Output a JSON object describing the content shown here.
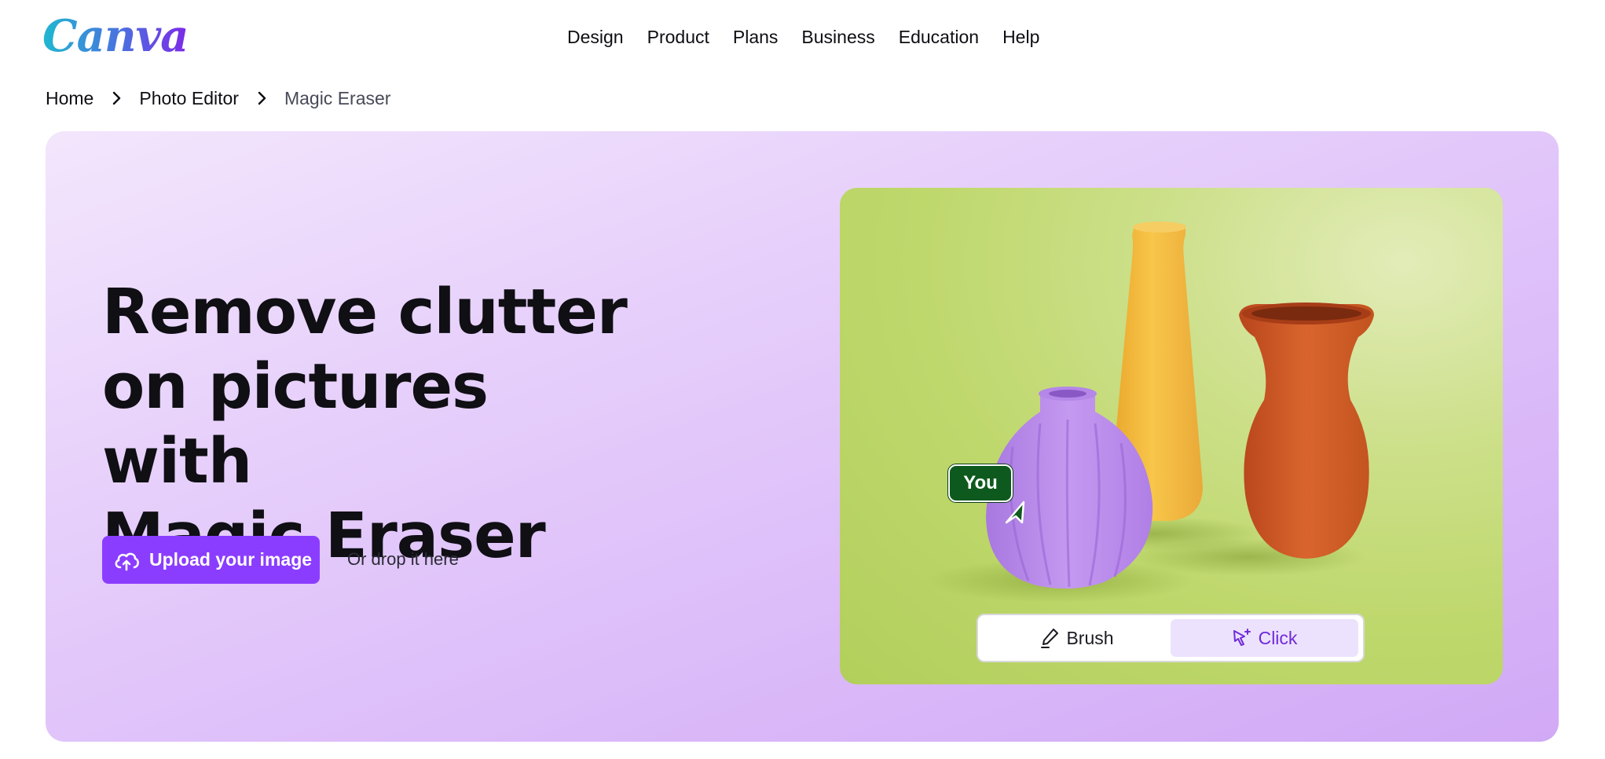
{
  "brand": {
    "logo_text": "Canva"
  },
  "nav": {
    "items": [
      "Design",
      "Product",
      "Plans",
      "Business",
      "Education",
      "Help"
    ]
  },
  "breadcrumb": {
    "items": [
      "Home",
      "Photo Editor",
      "Magic Eraser"
    ]
  },
  "hero": {
    "title_lines": [
      "Remove clutter",
      "on pictures with",
      "Magic Eraser"
    ],
    "upload_label": "Upload your image",
    "drop_text": "Or drop it here",
    "accent_color": "#8b3dff"
  },
  "preview": {
    "cursor_tag": "You",
    "tools": [
      {
        "label": "Brush",
        "icon": "brush-icon",
        "selected": false
      },
      {
        "label": "Click",
        "icon": "click-cursor-icon",
        "selected": true
      }
    ]
  }
}
